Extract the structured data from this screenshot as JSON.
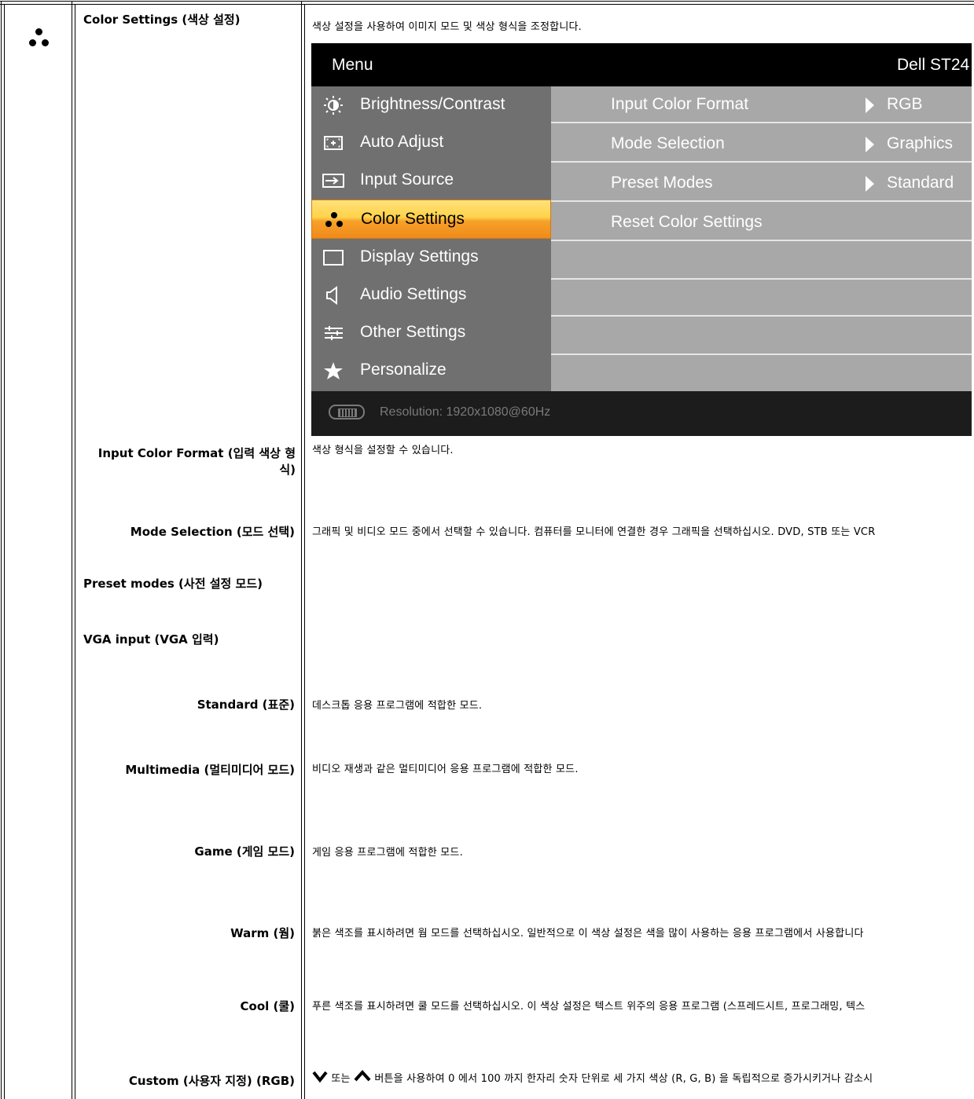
{
  "section": {
    "title": "Color Settings (색상 설정)",
    "intro": "색상 설정을 사용하여 이미지 모드 및 색상 형식을 조정합니다."
  },
  "osd": {
    "menu_title": "Menu",
    "model": "Dell ST24",
    "items": [
      {
        "label": "Brightness/Contrast",
        "icon": "brightness-icon"
      },
      {
        "label": "Auto Adjust",
        "icon": "auto-adjust-icon"
      },
      {
        "label": "Input Source",
        "icon": "input-source-icon"
      },
      {
        "label": "Color Settings",
        "icon": "color-settings-icon",
        "selected": true
      },
      {
        "label": "Display Settings",
        "icon": "display-settings-icon"
      },
      {
        "label": "Audio Settings",
        "icon": "speaker-icon"
      },
      {
        "label": "Other Settings",
        "icon": "sliders-icon"
      },
      {
        "label": "Personalize",
        "icon": "star-icon"
      }
    ],
    "rows": [
      {
        "key": "Input Color Format",
        "value": "RGB"
      },
      {
        "key": "Mode Selection",
        "value": "Graphics"
      },
      {
        "key": "Preset Modes",
        "value": "Standard"
      },
      {
        "key": "Reset Color Settings",
        "value": ""
      }
    ],
    "footer": "Resolution:  1920x1080@60Hz",
    "colors": {
      "selected_top": "#ffe27a",
      "selected_bottom": "#f08a1a",
      "left_panel": "#707070",
      "right_panel": "#a8a8a8"
    }
  },
  "rows": {
    "input_color_format": {
      "label": "Input Color Format (입력 색상 형",
      "label2": "식)",
      "desc": "색상 형식을 설정할 수 있습니다."
    },
    "mode_selection": {
      "label": "Mode Selection (모드 선택)",
      "desc": "그래픽 및 비디오 모드 중에서 선택할 수 있습니다. 컴퓨터를 모니터에 연결한 경우 그래픽을 선택하십시오. DVD, STB 또는 VCR"
    },
    "preset_modes": {
      "label": "Preset modes (사전 설정 모드)"
    },
    "vga_input": {
      "label": "VGA input (VGA 입력)"
    },
    "standard": {
      "label": "Standard (표준)",
      "desc": "데스크톱 응용 프로그램에 적합한 모드."
    },
    "multimedia": {
      "label": "Multimedia  (멀티미디어 모드)",
      "desc": "비디오 재생과 같은 멀티미디어 응용 프로그램에 적합한 모드."
    },
    "game": {
      "label": "Game (게임 모드)",
      "desc": "게임 응용 프로그램에 적합한 모드."
    },
    "warm": {
      "label": "Warm (웜)",
      "desc": "붉은 색조를 표시하려면 웜 모드를 선택하십시오. 일반적으로 이 색상 설정은 색을 많이 사용하는 응용 프로그램에서 사용합니다"
    },
    "cool": {
      "label": "Cool (쿨)",
      "desc": "푸른 색조를 표시하려면 쿨 모드를 선택하십시오. 이 색상 설정은 텍스트 위주의 응용 프로그램 (스프레드시트, 프로그래밍, 텍스"
    },
    "custom": {
      "label": "Custom (사용자 지정) (RGB)",
      "or_text": "또는",
      "desc": "버튼을 사용하여 0 에서 100 까지 한자리 숫자 단위로 세 가지 색상 (R, G, B) 을 독립적으로 증가시키거나 감소시"
    }
  }
}
